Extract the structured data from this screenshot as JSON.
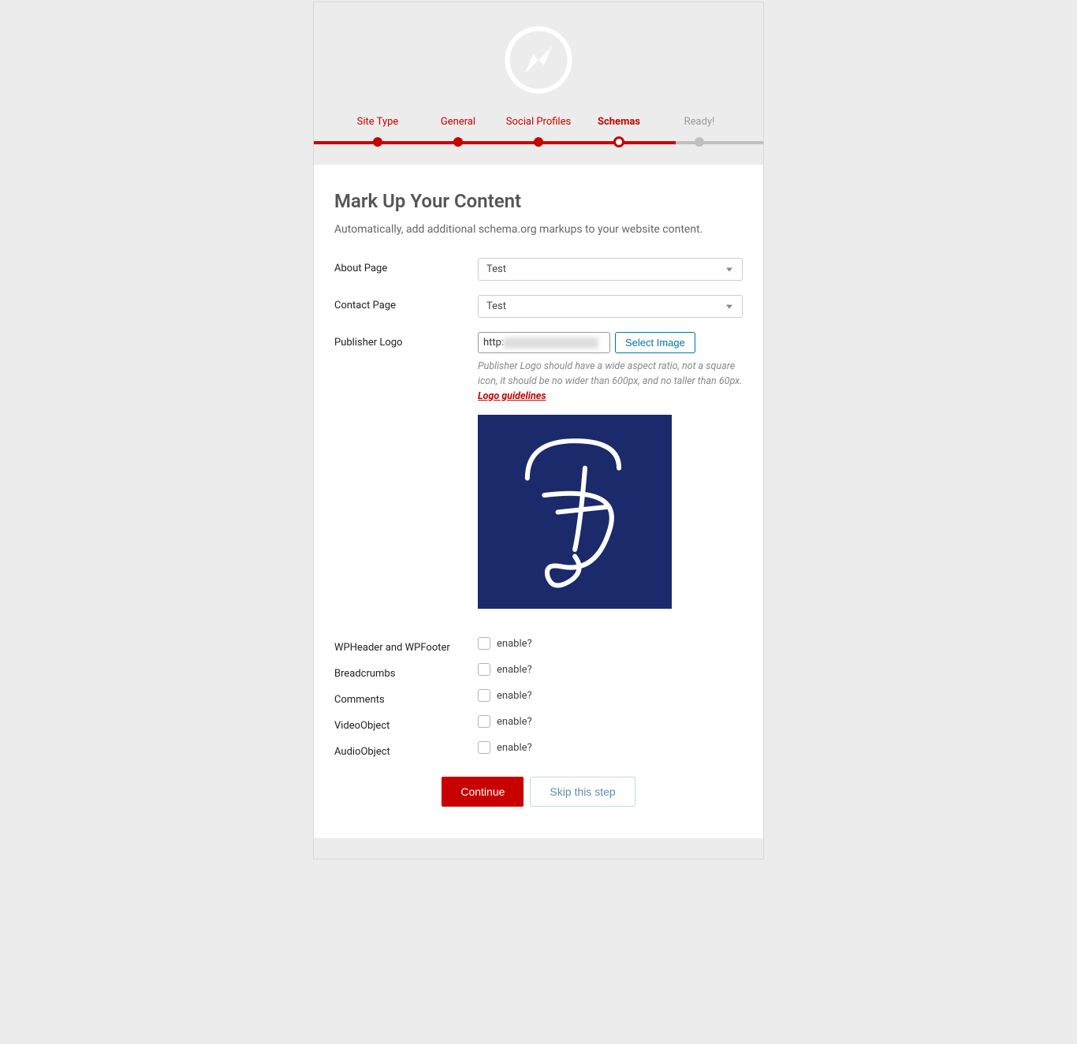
{
  "steps": {
    "items": [
      {
        "label": "Site Type"
      },
      {
        "label": "General"
      },
      {
        "label": "Social Profiles"
      },
      {
        "label": "Schemas"
      },
      {
        "label": "Ready!"
      }
    ]
  },
  "page": {
    "title": "Mark Up Your Content",
    "desc": "Automatically, add additional schema.org markups to your website content."
  },
  "about": {
    "label": "About Page",
    "value": "Test"
  },
  "contact": {
    "label": "Contact Page",
    "value": "Test"
  },
  "publisher": {
    "label": "Publisher Logo",
    "url_prefix": "http:",
    "select_btn": "Select Image",
    "hint1": "Publisher Logo should have a wide aspect ratio, not a square icon, it should be no wider than 600px, and no taller than 60px.",
    "hint2": "Logo guidelines"
  },
  "toggles": {
    "wpheader": {
      "label": "WPHeader and WPFooter",
      "check": "enable?"
    },
    "breadcrumbs": {
      "label": "Breadcrumbs",
      "check": "enable?"
    },
    "comments": {
      "label": "Comments",
      "check": "enable?"
    },
    "video": {
      "label": "VideoObject",
      "check": "enable?"
    },
    "audio": {
      "label": "AudioObject",
      "check": "enable?"
    }
  },
  "actions": {
    "continue": "Continue",
    "skip": "Skip this step"
  }
}
